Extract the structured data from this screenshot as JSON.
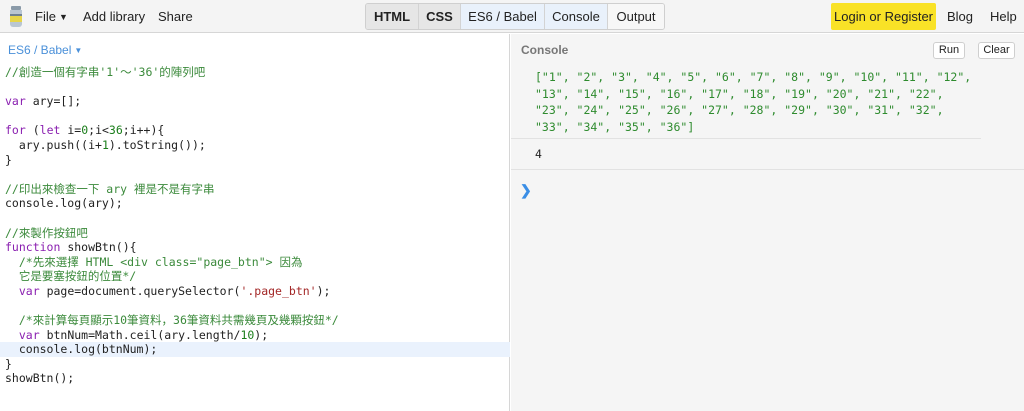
{
  "topbar": {
    "logo_icon": "jsbin-bottle-icon",
    "file_label": "File",
    "add_library_label": "Add library",
    "share_label": "Share",
    "tabs": [
      {
        "label": "HTML",
        "state": "active"
      },
      {
        "label": "CSS",
        "state": "active"
      },
      {
        "label": "ES6 / Babel",
        "state": "selected"
      },
      {
        "label": "Console",
        "state": "selected"
      },
      {
        "label": "Output",
        "state": "normal"
      }
    ],
    "login_label": "Login or Register",
    "blog_label": "Blog",
    "help_label": "Help"
  },
  "editor": {
    "language_label": "ES6 / Babel",
    "lines": [
      "//創造一個有字串'1'～'36'的陣列吧",
      "",
      "var ary=[];",
      "",
      "for (let i=0;i<36;i++){",
      "  ary.push((i+1).toString());",
      "}",
      "",
      "//印出來檢查一下 ary 裡是不是有字串",
      "console.log(ary);",
      "",
      "//來製作按鈕吧",
      "function showBtn(){",
      "  /*先來選擇 HTML <div class=\"page_btn\"> 因為",
      "  它是要塞按鈕的位置*/",
      "  var page=document.querySelector('.page_btn');",
      "",
      "  /*來計算每頁顯示10筆資料，36筆資料共需幾頁及幾顆按鈕*/",
      "  var btnNum=Math.ceil(ary.length/10);",
      "  console.log(btnNum);",
      "}",
      "showBtn();"
    ],
    "active_line": 19
  },
  "console": {
    "title": "Console",
    "run_label": "Run",
    "clear_label": "Clear",
    "array_output": "[\"1\", \"2\", \"3\", \"4\", \"5\", \"6\", \"7\", \"8\", \"9\", \"10\", \"11\", \"12\", \"13\", \"14\", \"15\", \"16\", \"17\", \"18\", \"19\", \"20\", \"21\", \"22\", \"23\", \"24\", \"25\", \"26\", \"27\", \"28\", \"29\", \"30\", \"31\", \"32\", \"33\", \"34\", \"35\", \"36\"]",
    "number_output": "4",
    "prompt_symbol": "❯"
  },
  "colors": {
    "accent_blue": "#4a90d9",
    "login_yellow": "#f9e227",
    "comment_green": "#3b8a3b",
    "keyword_purple": "#8a1fb0",
    "console_green": "#2e8b2e"
  }
}
